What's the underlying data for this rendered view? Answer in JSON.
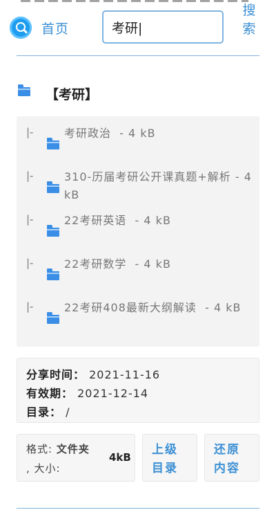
{
  "header": {
    "home_label": "首页",
    "search_value": "考研|",
    "search_button": "搜索"
  },
  "folder": {
    "title": "【考研】",
    "items": [
      {
        "prefix": "|-",
        "name": "考研政治",
        "size": "- 4 kB"
      },
      {
        "prefix": "|-",
        "name": "310-历届考研公开课真题+解析",
        "size": "- 4 kB"
      },
      {
        "prefix": "|-",
        "name": "22考研英语",
        "size": "- 4 kB"
      },
      {
        "prefix": "|-",
        "name": "22考研数学",
        "size": "- 4 kB"
      },
      {
        "prefix": "|-",
        "name": "22考研408最新大纲解读",
        "size": "- 4 kB"
      }
    ]
  },
  "info": {
    "share_time_label": "分享时间：",
    "share_time": "2021-11-16",
    "expiry_label": "有效期：",
    "expiry": "2021-12-14",
    "dir_label": "目录：",
    "dir": "/"
  },
  "format": {
    "format_label": "格式:",
    "format_value": "文件夹",
    "size_label": ", 大小:",
    "size_value": "4kB"
  },
  "buttons": {
    "parent_dir": "上级目录",
    "restore": "还原内容"
  },
  "colors": {
    "accent": "#3b8fd4",
    "folder_icon": "#3a8ee6"
  }
}
